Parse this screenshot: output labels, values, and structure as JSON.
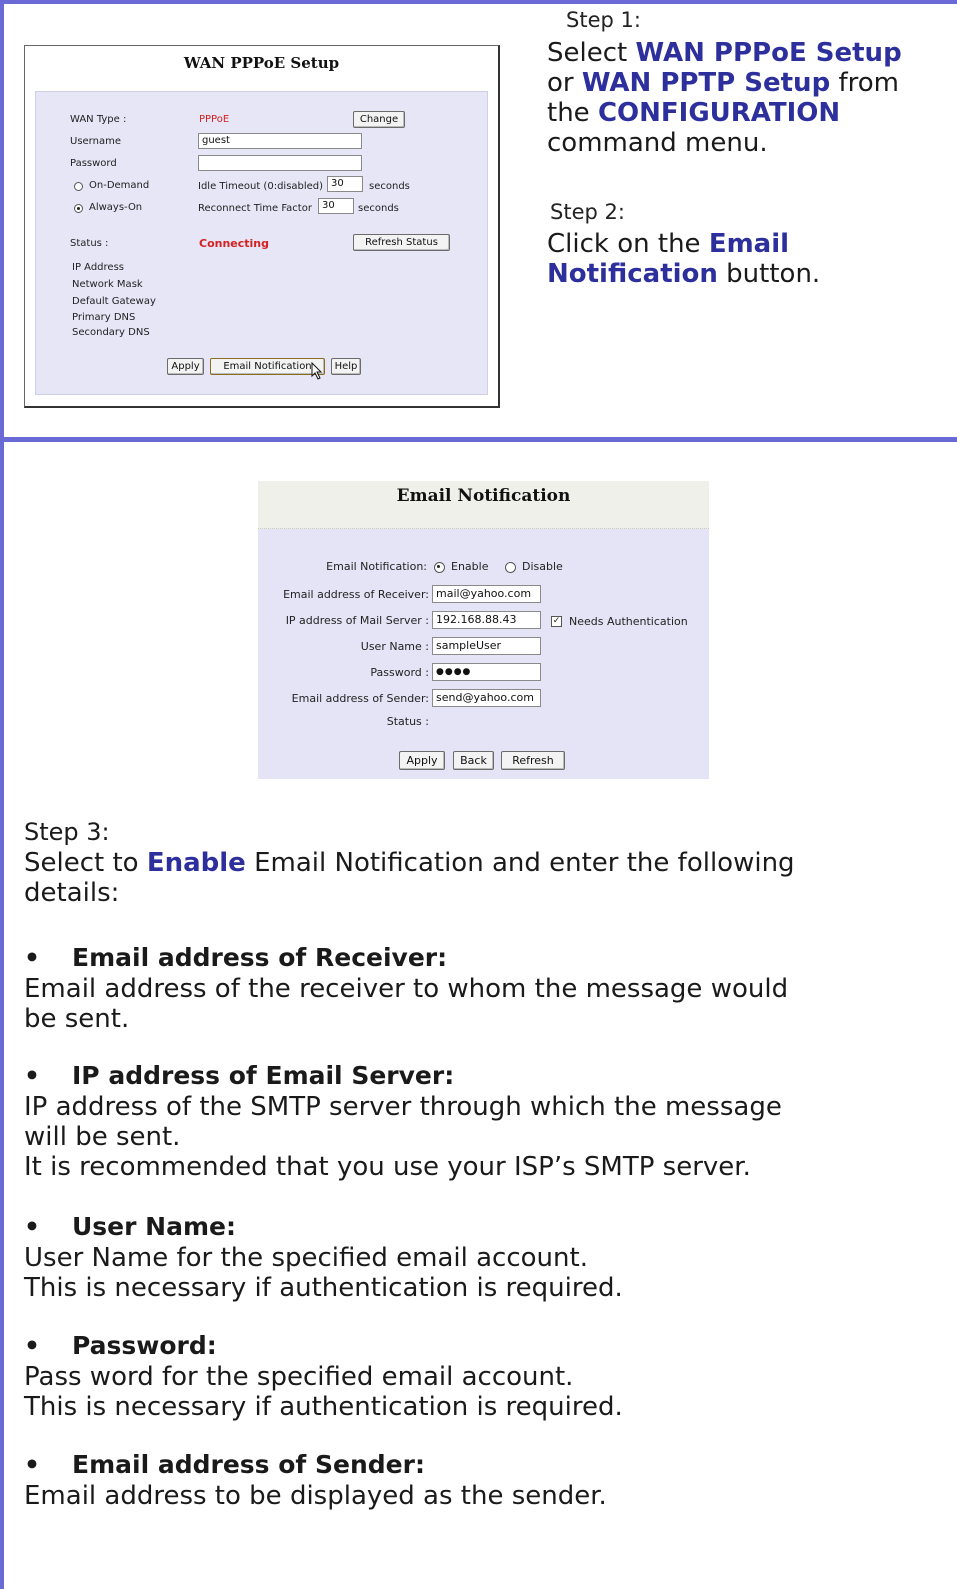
{
  "wan_panel": {
    "title": "WAN PPPoE Setup",
    "wan_type_label": "WAN Type :",
    "wan_type_value": "PPPoE",
    "change_button": "Change",
    "username_label": "Username",
    "username_value": "guest",
    "password_label": "Password",
    "on_demand_label": "On-Demand",
    "idle_timeout_label": "Idle Timeout (0:disabled)",
    "idle_timeout_value": "30",
    "seconds_label_1": "seconds",
    "always_on_label": "Always-On",
    "reconnect_label": "Reconnect Time Factor",
    "reconnect_value": "30",
    "seconds_label_2": "seconds",
    "status_label": "Status :",
    "status_value": "Connecting",
    "refresh_status_button": "Refresh Status",
    "ip_address_label": "IP Address",
    "network_mask_label": "Network Mask",
    "default_gateway_label": "Default Gateway",
    "primary_dns_label": "Primary DNS",
    "secondary_dns_label": "Secondary DNS",
    "apply_button": "Apply",
    "email_notification_button": "Email Notification",
    "help_button": "Help"
  },
  "step1": {
    "number": "Step 1:",
    "line1_a": "Select ",
    "line1_b": "WAN PPPoE Setup",
    "line2_a": "or ",
    "line2_b": "WAN PPTP Setup",
    "line2_c": " from",
    "line3_a": "the ",
    "line3_b": "CONFIGURATION",
    "line4": "command menu."
  },
  "step2": {
    "number": "Step 2:",
    "line1_a": "Click on the ",
    "line1_b": "Email",
    "line2_a": "Notification",
    "line2_b": " button."
  },
  "email_panel": {
    "title": "Email Notification",
    "notification_label": "Email Notification:",
    "enable_label": "Enable",
    "disable_label": "Disable",
    "receiver_label": "Email address of Receiver:",
    "receiver_value": "mail@yahoo.com",
    "server_label": "IP address of Mail Server :",
    "server_value": "192.168.88.43",
    "needs_auth_label": "Needs Authentication",
    "username_label": "User Name :",
    "username_value": "sampleUser",
    "password_label": "Password :",
    "password_value": "●●●●",
    "sender_label": "Email address of Sender:",
    "sender_value": "send@yahoo.com",
    "status_label": "Status :",
    "apply_button": "Apply",
    "back_button": "Back",
    "refresh_button": "Refresh"
  },
  "step3": {
    "number": "Step 3:",
    "line1_a": "Select to ",
    "line1_b": "Enable",
    "line1_c": " Email Notification and enter the following",
    "line2": "details:"
  },
  "bullets": [
    {
      "title": "Email address of Receiver:",
      "lines": [
        "Email address of the receiver to whom the message would",
        "be sent."
      ]
    },
    {
      "title": "IP address of Email Server:",
      "lines": [
        "IP address of the SMTP server through which the message",
        "will be sent.",
        "It is recommended that you use your ISP’s SMTP server."
      ]
    },
    {
      "title": "User Name:",
      "lines": [
        "User Name for the specified email account.",
        "This is necessary if authentication is required."
      ]
    },
    {
      "title": "Password:",
      "lines": [
        "Pass word for the specified email account.",
        "This is necessary if authentication is required."
      ]
    },
    {
      "title": "Email address of Sender:",
      "lines": [
        "Email address to be displayed as the sender."
      ]
    }
  ],
  "bullet_symbol": "•"
}
